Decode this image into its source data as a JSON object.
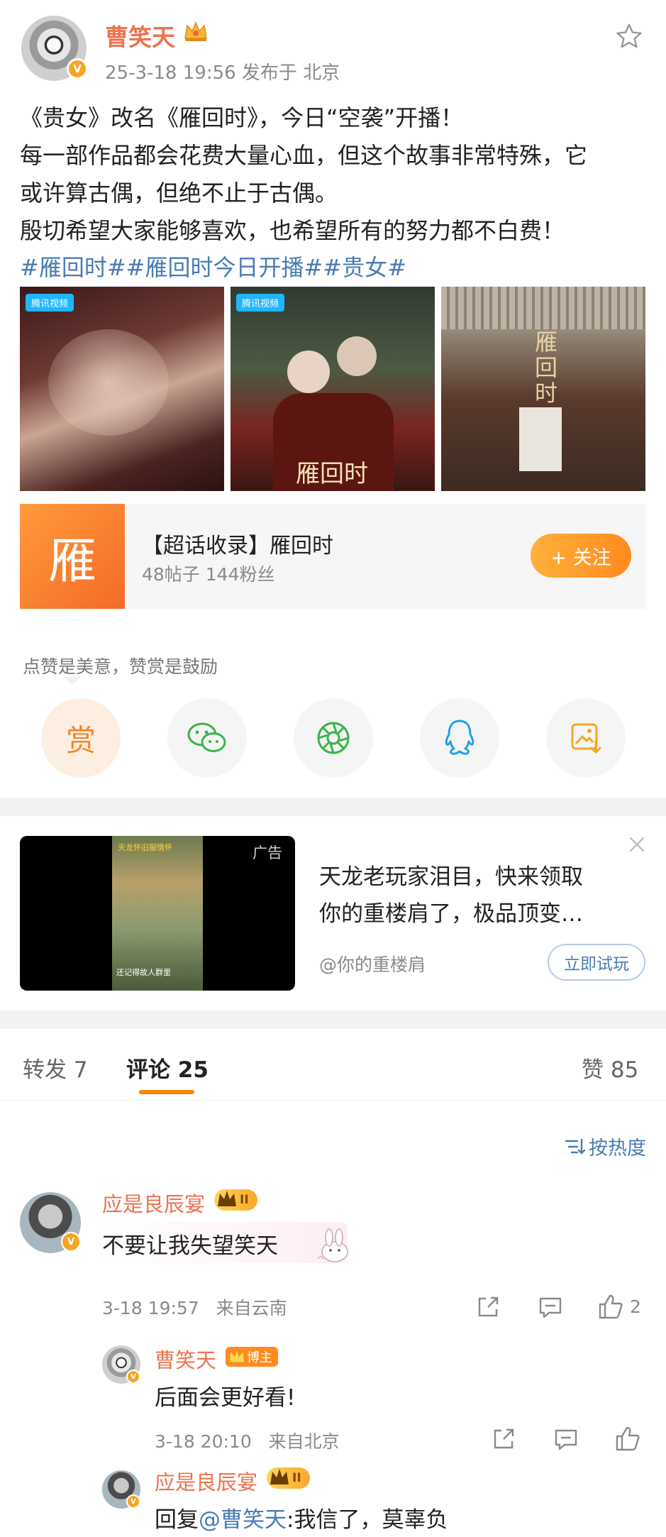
{
  "post": {
    "author": "曹笑天",
    "meta": "25-3-18 19:56  发布于 北京",
    "lines": [
      "《贵女》改名《雁回时》，今日“空袭”开播！",
      "每一部作品都会花费大量心血，但这个故事非常特殊，它",
      "或许算古偶，但绝不止于古偶。",
      "殷切希望大家能够喜欢，也希望所有的努力都不白费！"
    ],
    "hashtags": "#雁回时##雁回时今日开播##贵女#",
    "image_watermark": "腾讯视频",
    "image2_title": "雁回时",
    "image3_title": "雁回时"
  },
  "topic": {
    "logo_char": "雁",
    "title": "【超话收录】雁回时",
    "stats": "48帖子 144粉丝",
    "follow_label": "+ 关注"
  },
  "reward": {
    "tip": "点赞是美意，赞赏是鼓励",
    "reward_char": "赏",
    "accent": "#f2872c"
  },
  "ad": {
    "label": "广告",
    "thumb_label": "天龙怀旧服情怀",
    "thumb_caption": "还记得故人群里",
    "title_line1": "天龙老玩家泪目，快来领取",
    "title_line2": "你的重楼肩了，极品顶变…",
    "source": "@你的重楼肩",
    "button": "立即试玩"
  },
  "tabs": {
    "repost": "转发 7",
    "comment": "评论 25",
    "like": "赞 85"
  },
  "sort": {
    "label": "按热度"
  },
  "comments": [
    {
      "name": "应是良辰宴",
      "level": "II",
      "text": "不要让我失望笑天",
      "time": "3-18 19:57",
      "loc": "来自云南",
      "likes": "2"
    }
  ],
  "replies": [
    {
      "name": "曹笑天",
      "badge": "博主",
      "text": "后面会更好看!",
      "time": "3-18 20:10",
      "loc": "来自北京"
    },
    {
      "name": "应是良辰宴",
      "level": "II",
      "prefix": "回复",
      "mention": "@曹笑天",
      "text": ":我信了，莫辜负"
    }
  ],
  "colors": {
    "name_orange": "#eb7350",
    "link_blue": "#4a7bb4",
    "follow_orange": "#ff8a1f",
    "tab_underline": "#ff8200"
  },
  "icons": [
    "crown-icon",
    "star-icon",
    "wechat-icon",
    "moments-icon",
    "qq-icon",
    "save-image-icon",
    "close-icon",
    "sort-icon",
    "share-icon",
    "comment-icon",
    "like-icon"
  ]
}
